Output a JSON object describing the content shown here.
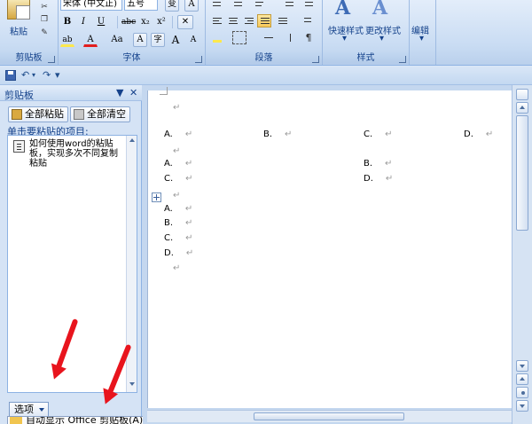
{
  "ribbon": {
    "groups": {
      "clipboard": "剪贴板",
      "font": "字体",
      "paragraph": "段落",
      "styles": "样式",
      "edit": "编辑"
    },
    "paste_label": "粘贴",
    "font_name": "宋体 (中文正)",
    "font_size": "五号",
    "quick_styles": "快速样式",
    "change_styles": "更改样式",
    "edit_label": "编辑",
    "buttons": {
      "bold": "B",
      "italic": "I",
      "underline": "U",
      "strikethrough": "abc",
      "subscript": "x₂",
      "superscript": "x²",
      "clear_format": "Aa",
      "char_border": "A",
      "enclosed": "字",
      "grow": "A",
      "shrink": "A",
      "phonetic": "变",
      "box_a": "A",
      "highlight": "ab",
      "font_color": "A"
    }
  },
  "qat": {
    "undo": "↶",
    "redo": "↷",
    "custom": "▾"
  },
  "clipboard_pane": {
    "title": "剪贴板",
    "paste_all": "全部粘贴",
    "clear_all": "全部清空",
    "hint": "单击要粘贴的项目:",
    "items": [
      "如何使用word的粘贴板，实现多次不同复制粘贴"
    ],
    "options_label": "选项",
    "menu_item": "自动显示 Office 剪贴板(A)"
  },
  "document": {
    "para_mark": "↵",
    "rows": [
      {
        "cols": []
      },
      {
        "cols": [
          "A.",
          "B.",
          "C.",
          "D."
        ]
      },
      {
        "cols": []
      },
      {
        "cols": [
          "A.",
          "B."
        ]
      },
      {
        "cols": [
          "C.",
          "D."
        ]
      },
      {
        "cols": []
      },
      {
        "cols": [
          "A."
        ]
      },
      {
        "cols": [
          "B."
        ]
      },
      {
        "cols": [
          "C."
        ]
      },
      {
        "cols": [
          "D."
        ]
      },
      {
        "cols": []
      }
    ]
  },
  "colors": {
    "ribbon_bg": "#c9dcf3",
    "accent": "#15428b",
    "arrow": "#e8141d",
    "highlight": "#fce84d",
    "font_color": "#e21e1e"
  }
}
